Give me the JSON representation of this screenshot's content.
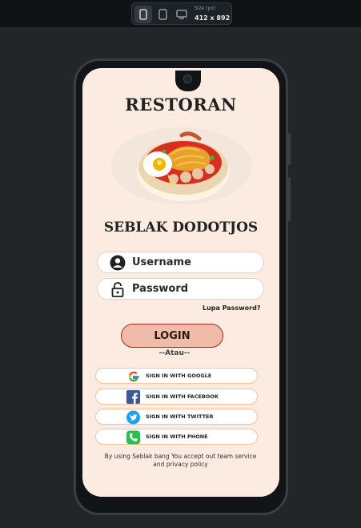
{
  "toolbar": {
    "size_label": "Size (px)",
    "size_value": "412 x 892",
    "devices": [
      "mobile",
      "tablet",
      "desktop"
    ]
  },
  "app": {
    "title": "RESTORAN",
    "subtitle": "SEBLAK DODOTJOS",
    "username_placeholder": "Username",
    "password_placeholder": "Password",
    "forgot_label": "Lupa Password?",
    "login_label": "LOGIN",
    "separator": "--Atau--",
    "social": [
      {
        "label": "SIGN IN WITH GOOGLE",
        "icon": "google-icon"
      },
      {
        "label": "SIGN IN WITH FACEBOOK",
        "icon": "facebook-icon"
      },
      {
        "label": "SIGN IN WITH TWITTER",
        "icon": "twitter-icon"
      },
      {
        "label": "SIGN IN WITH PHONE",
        "icon": "phone-icon"
      }
    ],
    "terms": "By using Seblak bang You accept out team service and privacy policy"
  },
  "colors": {
    "screen_bg": "#fbebe0",
    "login_fill": "#f1bba9",
    "login_border": "#b12323",
    "facebook": "#3b5998",
    "twitter": "#1da1f2",
    "phone": "#2dbd52"
  }
}
